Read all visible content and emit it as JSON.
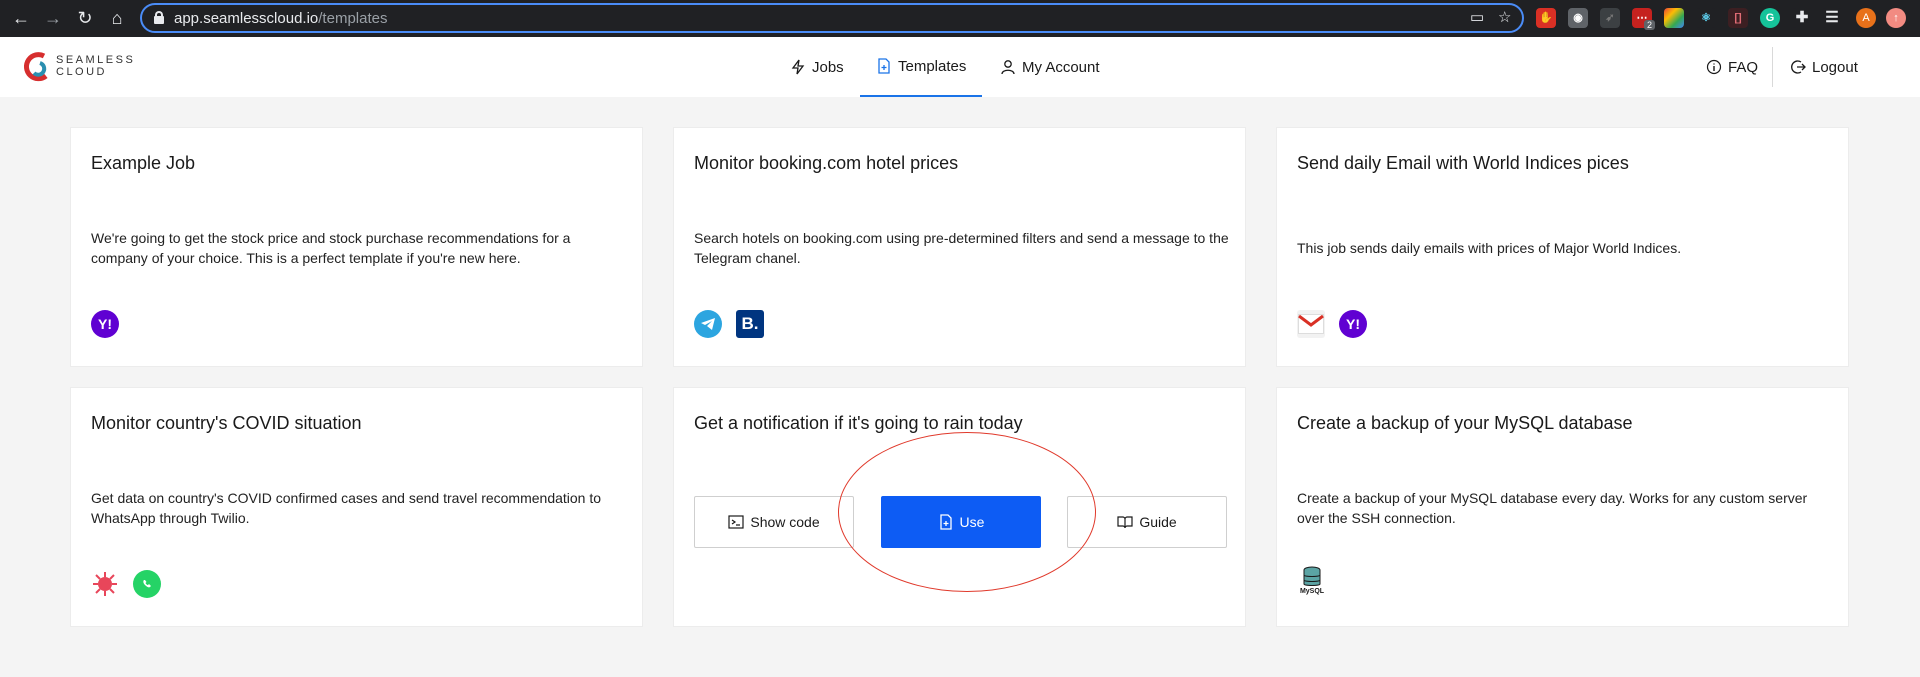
{
  "browser": {
    "url_host": "app.seamlesscloud.io",
    "url_path": "/templates",
    "ext_badge": "2",
    "profile_initial": "A"
  },
  "header": {
    "logo_line1": "SEAMLESS",
    "logo_line2": "CLOUD",
    "nav": {
      "jobs": "Jobs",
      "templates": "Templates",
      "my_account": "My Account"
    },
    "faq": "FAQ",
    "logout": "Logout"
  },
  "cards": [
    {
      "title": "Example Job",
      "description": "We're going to get the stock price and stock purchase recommendations for a company of your choice. This is a perfect template if you're new here.",
      "icons": [
        "yahoo-icon"
      ]
    },
    {
      "title": "Monitor booking.com hotel prices",
      "description": "Search hotels on booking.com using pre-determined filters and send a message to the Telegram chanel.",
      "icons": [
        "telegram-icon",
        "booking-icon"
      ]
    },
    {
      "title": "Send daily Email with World Indices pices",
      "description": "This job sends daily emails with prices of Major World Indices.",
      "icons": [
        "gmail-icon",
        "yahoo-icon"
      ]
    },
    {
      "title": "Monitor country's COVID situation",
      "description": "Get data on country's COVID confirmed cases and send travel recommendation to WhatsApp through Twilio.",
      "icons": [
        "virus-icon",
        "whatsapp-icon"
      ]
    },
    {
      "title": "Get a notification if it's going to rain today",
      "actions": {
        "show_code": "Show code",
        "use": "Use",
        "guide": "Guide"
      }
    },
    {
      "title": "Create a backup of your MySQL database",
      "description": "Create a backup of your MySQL database every day. Works for any custom server over the SSH connection.",
      "icons": [
        "mysql-icon"
      ],
      "mysql_label": "MySQL"
    }
  ],
  "colors": {
    "accent": "#0d5cf4",
    "yahoo": "#6001d2",
    "telegram": "#2ca5e0",
    "booking": "#003580",
    "whatsapp": "#25d366",
    "annotation": "#e0392b"
  }
}
